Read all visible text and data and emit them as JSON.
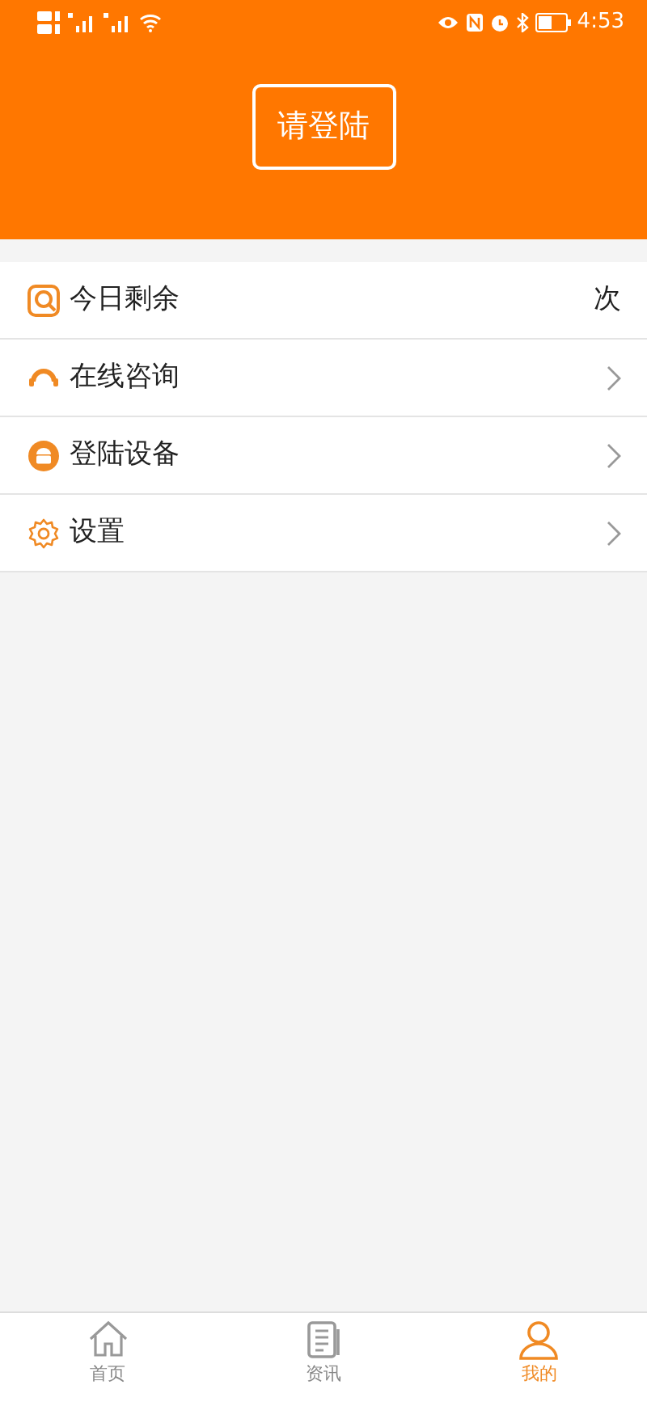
{
  "status_bar": {
    "time": "4:53"
  },
  "header": {
    "login_button": "请登陆"
  },
  "menu": [
    {
      "label": "今日剩余",
      "kind": "value",
      "value": "次"
    },
    {
      "label": "在线咨询",
      "kind": "link"
    },
    {
      "label": "登陆设备",
      "kind": "link"
    },
    {
      "label": "设置",
      "kind": "link"
    }
  ],
  "tabs": [
    {
      "label": "首页",
      "selected": false
    },
    {
      "label": "资讯",
      "selected": false
    },
    {
      "label": "我的",
      "selected": true
    }
  ]
}
